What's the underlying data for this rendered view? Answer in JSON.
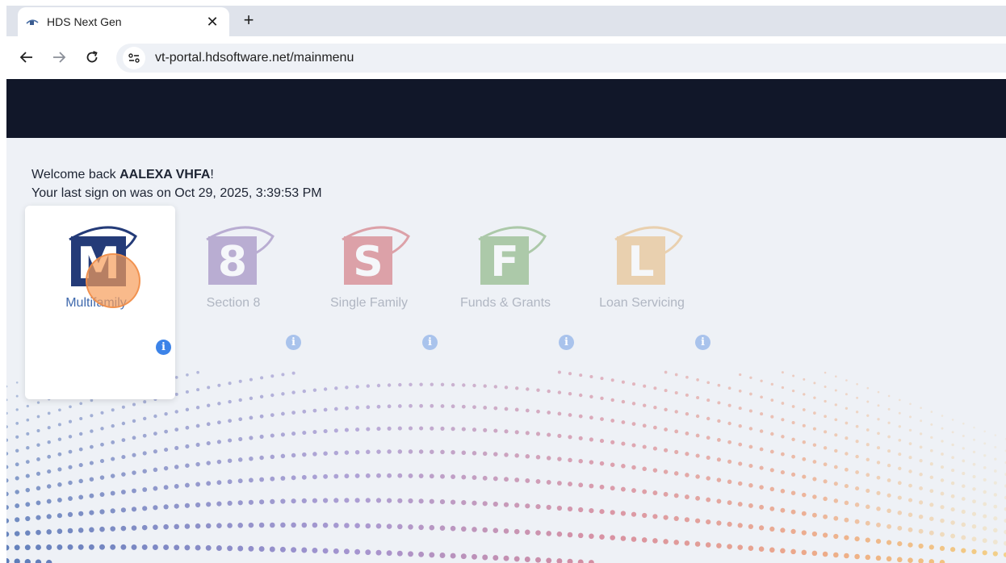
{
  "browser": {
    "tab_title": "HDS Next Gen",
    "close_symbol": "✕",
    "new_tab_symbol": "+",
    "url": "vt-portal.hdsoftware.net/mainmenu"
  },
  "welcome": {
    "prefix": "Welcome back ",
    "user": "AALEXA VHFA",
    "suffix": "!",
    "last_sign_on": "Your last sign on was on Oct 29, 2025, 3:39:53 PM"
  },
  "modules": [
    {
      "label": "Multifamily",
      "letter": "M",
      "color": "#243b78",
      "active": true
    },
    {
      "label": "Section 8",
      "letter": "8",
      "color": "#7a5ba8",
      "active": false
    },
    {
      "label": "Single Family",
      "letter": "S",
      "color": "#c8424a",
      "active": false
    },
    {
      "label": "Funds & Grants",
      "letter": "F",
      "color": "#5e9a4e",
      "active": false
    },
    {
      "label": "Loan Servicing",
      "letter": "L",
      "color": "#e3a95a",
      "active": false
    }
  ],
  "info_symbol": "i"
}
